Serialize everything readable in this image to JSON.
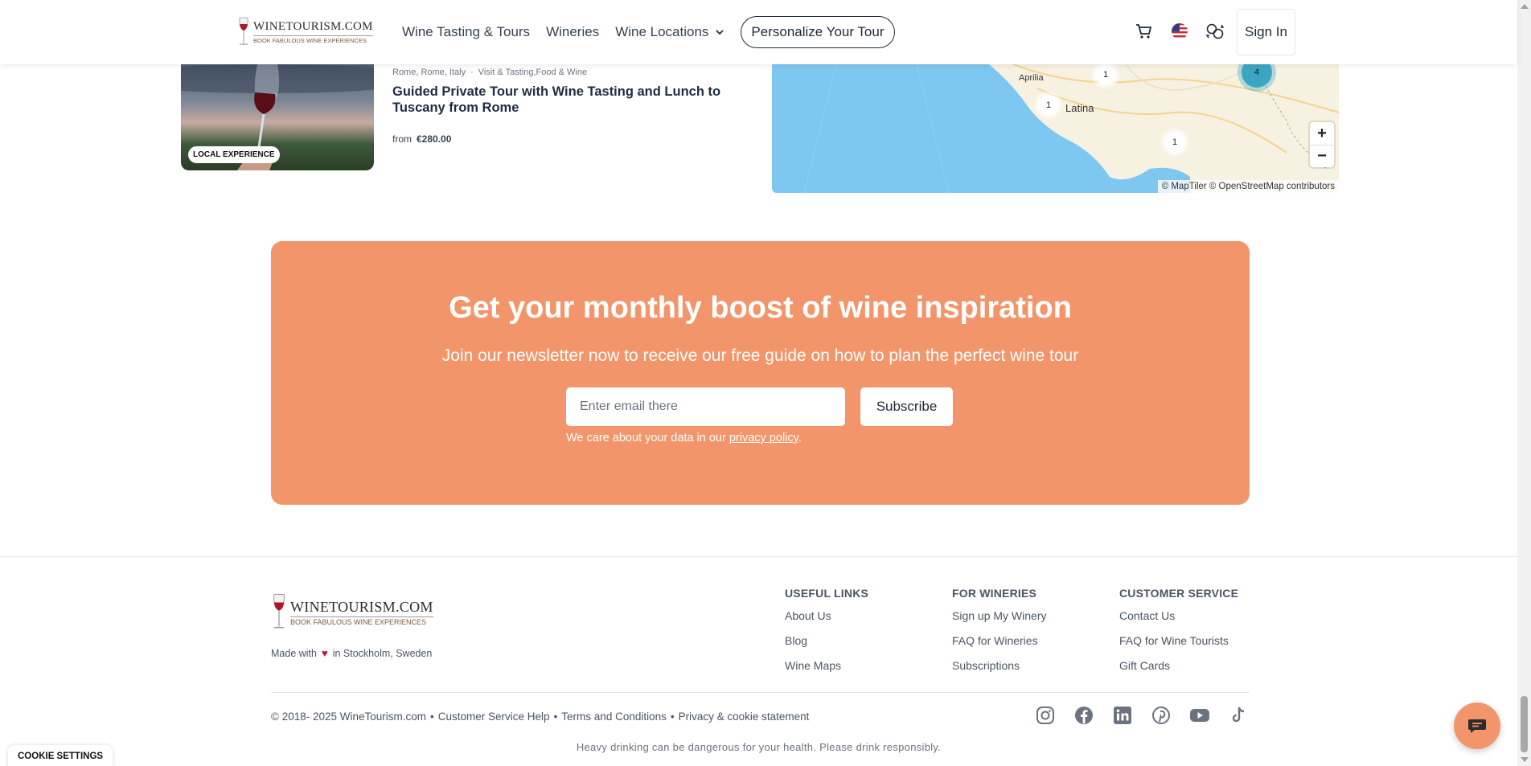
{
  "header": {
    "logo_name": "WINETOURISM.COM",
    "logo_tagline": "BOOK FABULOUS WINE EXPERIENCES",
    "nav": [
      "Wine Tasting & Tours",
      "Wineries",
      "Wine Locations"
    ],
    "personalize_label": "Personalize Your Tour",
    "signin_label": "Sign In",
    "icons": [
      "cart-icon",
      "us-flag-icon",
      "currency-exchange-icon"
    ]
  },
  "tour": {
    "badge": "LOCAL EXPERIENCE",
    "location": "Rome, Rome, Italy",
    "categories": "Visit & Tasting,Food & Wine",
    "title": "Guided Private Tour with Wine Tasting and Lunch to Tuscany from Rome",
    "price_prefix": "from",
    "price": "€280.00"
  },
  "map": {
    "cities": [
      "Aprilia",
      "Latina"
    ],
    "clusters": [
      "1",
      "4",
      "1",
      "1"
    ],
    "zoom_in": "+",
    "zoom_out": "−",
    "attribution": "© MapTiler © OpenStreetMap contributors",
    "colors": {
      "sea": "#7ec7f0",
      "land": "#f6f1e1",
      "cluster_big": "#3ba6c2"
    }
  },
  "newsletter": {
    "title": "Get your monthly boost of wine inspiration",
    "subtitle": "Join our newsletter now to receive our free guide on how to plan the perfect wine tour",
    "email_placeholder": "Enter email there",
    "subscribe_label": "Subscribe",
    "privacy_prefix": "We care about your data in our ",
    "privacy_link": "privacy policy",
    "privacy_suffix": ".",
    "bg_color": "#f2956b"
  },
  "footer": {
    "made_with_prefix": "Made with",
    "made_with_suffix": "in Stockholm, Sweden",
    "columns": [
      {
        "title": "USEFUL LINKS",
        "links": [
          "About Us",
          "Blog",
          "Wine Maps"
        ]
      },
      {
        "title": "FOR WINERIES",
        "links": [
          "Sign up My Winery",
          "FAQ for Wineries",
          "Subscriptions"
        ]
      },
      {
        "title": "CUSTOMER SERVICE",
        "links": [
          "Contact Us",
          "FAQ for Wine Tourists",
          "Gift Cards"
        ]
      }
    ],
    "copyright": "© 2018- 2025 WineTourism.com",
    "bottom_links": [
      "Customer Service Help",
      "Terms and Conditions",
      "Privacy & cookie statement"
    ],
    "separator": "•",
    "socials": [
      "instagram-icon",
      "facebook-icon",
      "linkedin-icon",
      "pinterest-icon",
      "youtube-icon",
      "tiktok-icon"
    ],
    "warning": "Heavy drinking can be dangerous for your health. Please drink responsibly."
  },
  "cookie_settings_label": "COOKIE SETTINGS"
}
